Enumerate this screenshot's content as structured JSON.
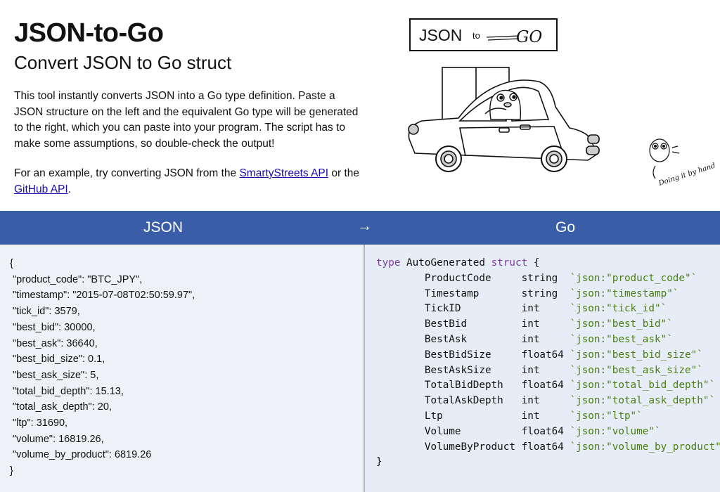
{
  "header": {
    "title": "JSON-to-Go",
    "subtitle": "Convert JSON to Go struct",
    "description": "This tool instantly converts JSON into a Go type definition. Paste a JSON structure on the left and the equivalent Go type will be generated to the right, which you can paste into your program. The script has to make some assumptions, so double-check the output!",
    "example_prefix": "For an example, try converting JSON from the ",
    "example_link1": "SmartyStreets API",
    "example_mid": " or the ",
    "example_link2": "GitHub API",
    "example_suffix": "."
  },
  "logo": {
    "json_text": "JSON",
    "to_text": "to",
    "go_text": "GO"
  },
  "gopher_caption": "Doing it by hand",
  "toolbar": {
    "json_label": "JSON",
    "arrow": "→",
    "go_label": "Go"
  },
  "json_input": "{\n \"product_code\": \"BTC_JPY\",\n \"timestamp\": \"2015-07-08T02:50:59.97\",\n \"tick_id\": 3579,\n \"best_bid\": 30000,\n \"best_ask\": 36640,\n \"best_bid_size\": 0.1,\n \"best_ask_size\": 5,\n \"total_bid_depth\": 15.13,\n \"total_ask_depth\": 20,\n \"ltp\": 31690,\n \"volume\": 16819.26,\n \"volume_by_product\": 6819.26\n}",
  "go_output": {
    "kw_type": "type",
    "struct_name": "AutoGenerated",
    "kw_struct": "struct",
    "open_brace": "{",
    "close_brace": "}",
    "fields": [
      {
        "name": "ProductCode",
        "type": "string",
        "tag": "`json:\"product_code\"`"
      },
      {
        "name": "Timestamp",
        "type": "string",
        "tag": "`json:\"timestamp\"`"
      },
      {
        "name": "TickID",
        "type": "int",
        "tag": "`json:\"tick_id\"`"
      },
      {
        "name": "BestBid",
        "type": "int",
        "tag": "`json:\"best_bid\"`"
      },
      {
        "name": "BestAsk",
        "type": "int",
        "tag": "`json:\"best_ask\"`"
      },
      {
        "name": "BestBidSize",
        "type": "float64",
        "tag": "`json:\"best_bid_size\"`"
      },
      {
        "name": "BestAskSize",
        "type": "int",
        "tag": "`json:\"best_ask_size\"`"
      },
      {
        "name": "TotalBidDepth",
        "type": "float64",
        "tag": "`json:\"total_bid_depth\"`"
      },
      {
        "name": "TotalAskDepth",
        "type": "int",
        "tag": "`json:\"total_ask_depth\"`"
      },
      {
        "name": "Ltp",
        "type": "int",
        "tag": "`json:\"ltp\"`"
      },
      {
        "name": "Volume",
        "type": "float64",
        "tag": "`json:\"volume\"`"
      },
      {
        "name": "VolumeByProduct",
        "type": "float64",
        "tag": "`json:\"volume_by_product\"`"
      }
    ]
  },
  "colors": {
    "toolbar_bg": "#3a5da8",
    "json_pane_bg": "#eef2f7",
    "go_pane_bg": "#e6edf6",
    "keyword": "#7a3e9d",
    "tag": "#4b7d12",
    "link": "#1a0dab"
  }
}
